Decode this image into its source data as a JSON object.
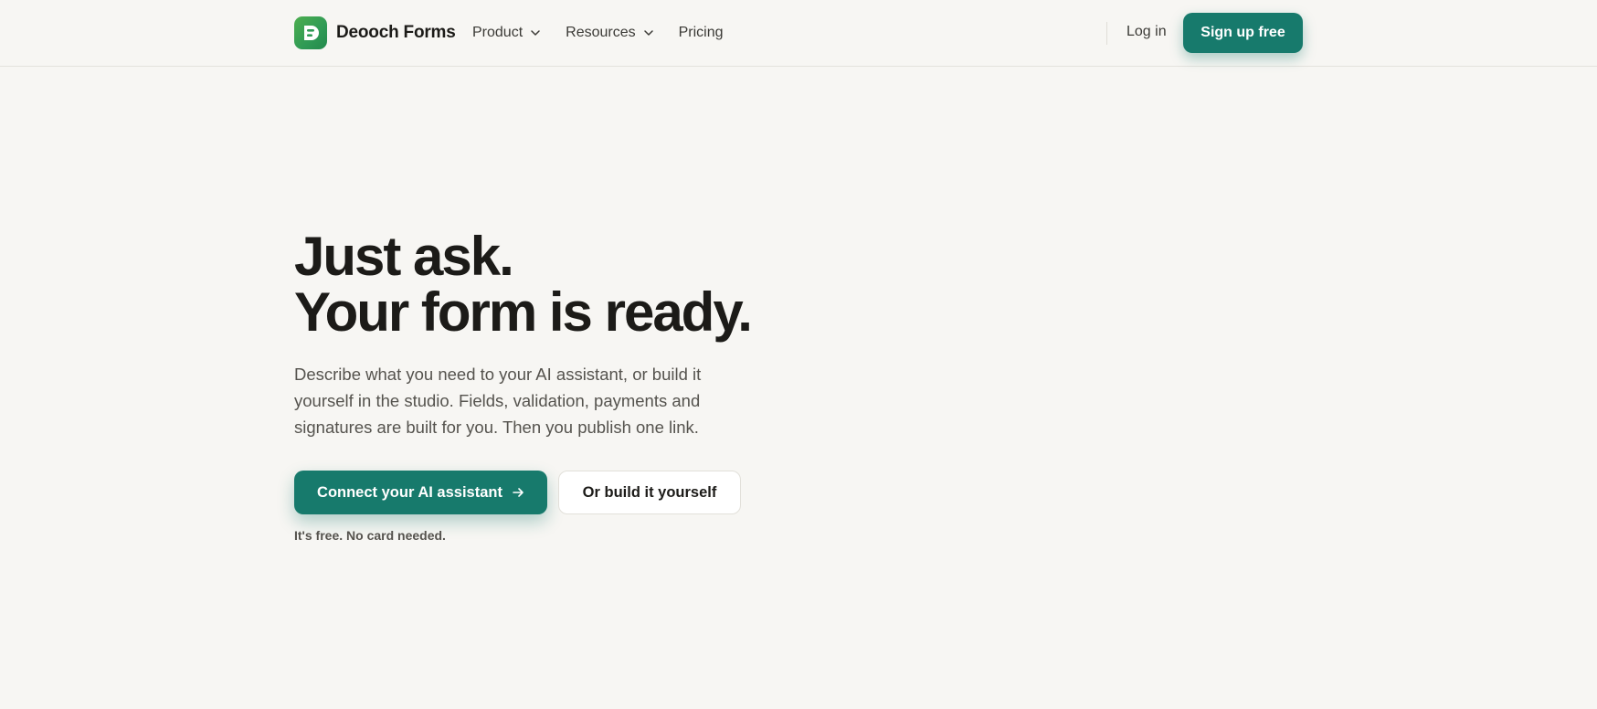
{
  "header": {
    "brand_name": "Deooch Forms",
    "logo_icon": "document-logo-icon",
    "nav": [
      {
        "label": "Product",
        "has_dropdown": true
      },
      {
        "label": "Resources",
        "has_dropdown": true
      },
      {
        "label": "Pricing",
        "has_dropdown": false
      }
    ],
    "login_label": "Log in",
    "signup_label": "Sign up free"
  },
  "hero": {
    "headline_line1": "Just ask.",
    "headline_line2": "Your form is ready.",
    "description": "Describe what you need to your AI assistant, or build it yourself in the studio. Fields, validation, payments and signatures are built for you. Then you publish one link.",
    "primary_cta": "Connect your AI assistant",
    "primary_cta_icon": "arrow-right-icon",
    "secondary_cta": "Or build it yourself",
    "note": "It's free. No card needed."
  },
  "colors": {
    "background": "#f7f6f3",
    "accent": "#177a6c",
    "logo_green": "#2f9a55",
    "text_primary": "#1c1b18",
    "text_secondary": "#55534e"
  }
}
